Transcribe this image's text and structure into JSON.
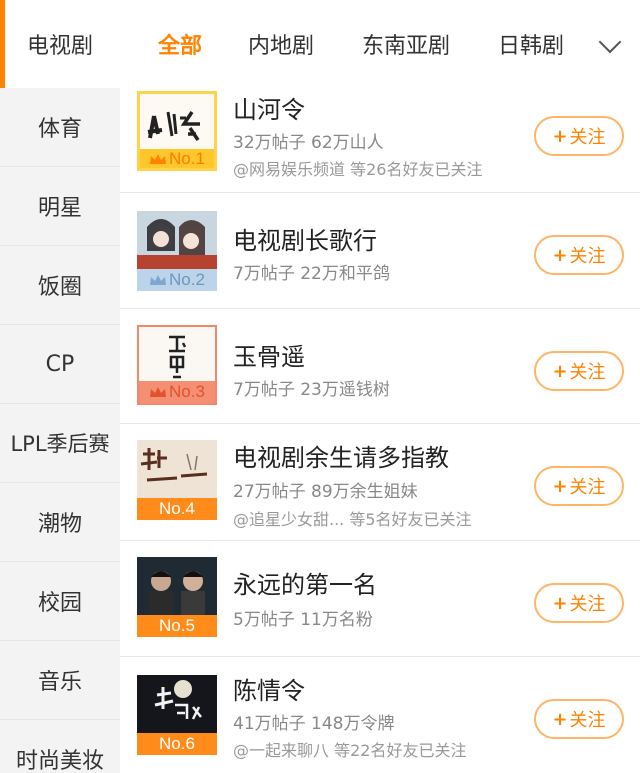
{
  "sidebar": {
    "items": [
      {
        "label": "电视剧"
      },
      {
        "label": "体育"
      },
      {
        "label": "明星"
      },
      {
        "label": "饭圈"
      },
      {
        "label": "CP"
      },
      {
        "label": "LPL季后赛"
      },
      {
        "label": "潮物"
      },
      {
        "label": "校园"
      },
      {
        "label": "音乐"
      },
      {
        "label": "时尚美妆"
      }
    ]
  },
  "tabs": [
    {
      "label": "全部"
    },
    {
      "label": "内地剧"
    },
    {
      "label": "东南亚剧"
    },
    {
      "label": "日韩剧"
    }
  ],
  "colors": {
    "accent": "#ff8200",
    "rank_top": "#ffc72c",
    "rank_other": "#ff8c1a"
  },
  "list": [
    {
      "title": "山河令",
      "stats": "32万帖子 62万山人",
      "friends": "@网易娱乐频道 等26名好友已关注",
      "rank": "No.1",
      "follow": "关注"
    },
    {
      "title": "电视剧长歌行",
      "stats": "7万帖子 22万和平鸽",
      "friends": "",
      "rank": "No.2",
      "follow": "关注"
    },
    {
      "title": "玉骨遥",
      "stats": "7万帖子 23万遥钱树",
      "friends": "",
      "rank": "No.3",
      "follow": "关注"
    },
    {
      "title": "电视剧余生请多指教",
      "stats": "27万帖子 89万余生姐妹",
      "friends": "@追星少女甜... 等5名好友已关注",
      "rank": "No.4",
      "follow": "关注"
    },
    {
      "title": "永远的第一名",
      "stats": "5万帖子 11万名粉",
      "friends": "",
      "rank": "No.5",
      "follow": "关注"
    },
    {
      "title": "陈情令",
      "stats": "41万帖子 148万令牌",
      "friends": "@一起来聊八 等22名好友已关注",
      "rank": "No.6",
      "follow": "关注"
    }
  ]
}
